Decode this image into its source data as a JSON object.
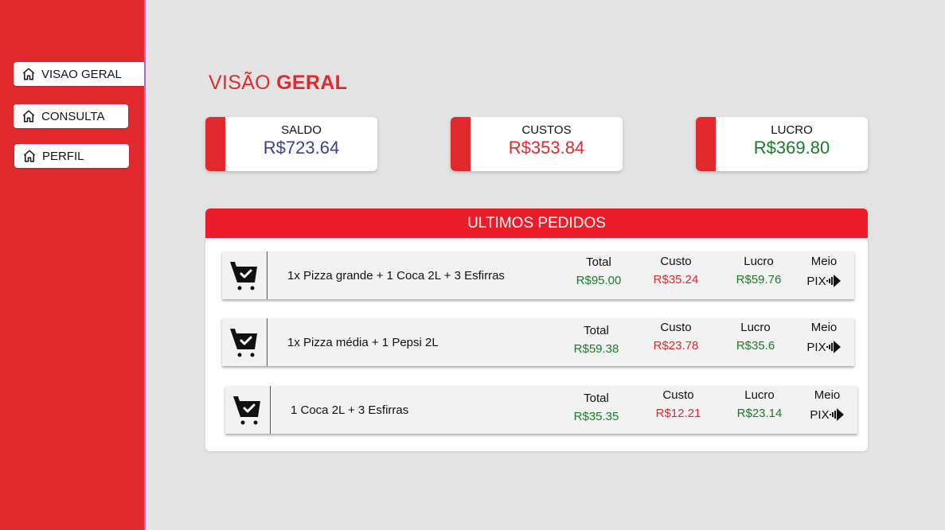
{
  "sidebar": {
    "items": [
      {
        "label": "VISAO GERAL",
        "icon": "home-icon"
      },
      {
        "label": "CONSULTA",
        "icon": "home-icon"
      },
      {
        "label": "PERFIL",
        "icon": "home-icon"
      }
    ]
  },
  "page": {
    "title_part1": "VISÃO ",
    "title_part2": "GERAL"
  },
  "summary": [
    {
      "label": "SALDO",
      "value": "R$723.64",
      "color": "#3e3f86"
    },
    {
      "label": "CUSTOS",
      "value": "R$353.84",
      "color": "#e1292e"
    },
    {
      "label": "LUCRO",
      "value": "R$369.80",
      "color": "#1b7a2a"
    }
  ],
  "orders_panel": {
    "title": "ULTIMOS PEDIDOS",
    "col_total": "Total",
    "col_custo": "Custo",
    "col_lucro": "Lucro",
    "col_meio": "Meio",
    "orders": [
      {
        "description": "1x Pizza grande + 1 Coca 2L + 3 Esfirras",
        "total": "R$95.00",
        "custo": "R$35.24",
        "lucro": "R$59.76",
        "meio": "PIX"
      },
      {
        "description": "1x Pizza média + 1 Pepsi 2L",
        "total": "R$59.38",
        "custo": "R$23.78",
        "lucro": "R$35.6",
        "meio": "PIX"
      },
      {
        "description": "1 Coca 2L + 3 Esfirras",
        "total": "R$35.35",
        "custo": "R$12.21",
        "lucro": "R$23.14",
        "meio": "PIX"
      }
    ]
  }
}
